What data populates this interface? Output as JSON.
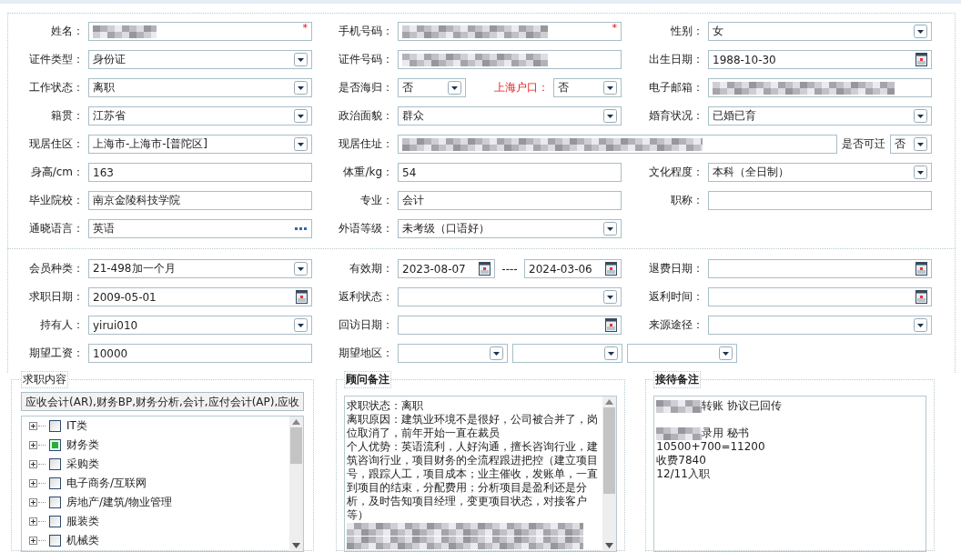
{
  "sections": [
    {
      "rows": [
        {
          "cells": [
            {
              "kind": "single",
              "label": "姓名：",
              "controls": [
                {
                  "kind": "text",
                  "redacted": true,
                  "required_mark": "*"
                }
              ]
            },
            {
              "kind": "single",
              "label": "手机号码：",
              "controls": [
                {
                  "kind": "text",
                  "redacted": true,
                  "required_mark": "*"
                }
              ]
            },
            {
              "kind": "single",
              "label": "性别：",
              "controls": [
                {
                  "kind": "select",
                  "value": "女"
                }
              ]
            }
          ]
        },
        {
          "cells": [
            {
              "kind": "single",
              "label": "证件类型：",
              "controls": [
                {
                  "kind": "select",
                  "value": "身份证"
                }
              ]
            },
            {
              "kind": "single",
              "label": "证件号码：",
              "controls": [
                {
                  "kind": "text",
                  "redacted": true
                }
              ]
            },
            {
              "kind": "single",
              "label": "出生日期：",
              "controls": [
                {
                  "kind": "date",
                  "value": "1988-10-30"
                }
              ]
            }
          ]
        },
        {
          "cells": [
            {
              "kind": "single",
              "label": "工作状态：",
              "controls": [
                {
                  "kind": "select",
                  "value": "离职"
                }
              ]
            },
            {
              "kind": "pair",
              "label": "是否海归：",
              "controls": [
                {
                  "kind": "select",
                  "value": "否"
                },
                {
                  "kind": "label",
                  "text": "上海户口：",
                  "emphasis": true
                },
                {
                  "kind": "select",
                  "value": "否"
                }
              ]
            },
            {
              "kind": "single",
              "label": "电子邮箱：",
              "controls": [
                {
                  "kind": "text",
                  "redacted": true
                }
              ]
            }
          ]
        },
        {
          "cells": [
            {
              "kind": "single",
              "label": "籍贯：",
              "controls": [
                {
                  "kind": "select",
                  "value": "江苏省"
                }
              ]
            },
            {
              "kind": "single",
              "label": "政治面貌：",
              "controls": [
                {
                  "kind": "select",
                  "value": "群众"
                }
              ]
            },
            {
              "kind": "single",
              "label": "婚育状况：",
              "controls": [
                {
                  "kind": "select",
                  "value": "已婚已育"
                }
              ]
            }
          ]
        },
        {
          "cells": [
            {
              "kind": "single",
              "label": "现居住区：",
              "controls": [
                {
                  "kind": "select",
                  "value": "上海市-上海市-[普陀区]"
                }
              ]
            },
            {
              "kind": "address",
              "label": "现居住址：",
              "controls": [
                {
                  "kind": "text",
                  "redacted": true
                },
                {
                  "kind": "label",
                  "text": "是否可迁"
                },
                {
                  "kind": "select",
                  "value": "否"
                }
              ]
            }
          ]
        },
        {
          "cells": [
            {
              "kind": "single",
              "label": "身高/cm：",
              "controls": [
                {
                  "kind": "text",
                  "value": "163"
                }
              ]
            },
            {
              "kind": "single",
              "label": "体重/kg：",
              "controls": [
                {
                  "kind": "text",
                  "value": "54"
                }
              ]
            },
            {
              "kind": "single",
              "label": "文化程度：",
              "controls": [
                {
                  "kind": "select",
                  "value": "本科（全日制）"
                }
              ]
            }
          ]
        },
        {
          "cells": [
            {
              "kind": "single",
              "label": "毕业院校：",
              "controls": [
                {
                  "kind": "text",
                  "value": "南京金陵科技学院"
                }
              ]
            },
            {
              "kind": "single",
              "label": "专业：",
              "controls": [
                {
                  "kind": "text",
                  "value": "会计"
                }
              ]
            },
            {
              "kind": "single",
              "label": "职称：",
              "controls": [
                {
                  "kind": "text"
                }
              ]
            }
          ]
        },
        {
          "cells": [
            {
              "kind": "single",
              "label": "通晓语言：",
              "controls": [
                {
                  "kind": "picker",
                  "value": "英语"
                }
              ]
            },
            {
              "kind": "single",
              "label": "外语等级：",
              "controls": [
                {
                  "kind": "select",
                  "value": "未考级（口语好）"
                }
              ]
            }
          ]
        }
      ]
    },
    {
      "rows": [
        {
          "cells": [
            {
              "kind": "single",
              "label": "会员种类：",
              "controls": [
                {
                  "kind": "select",
                  "value": "21-498加一个月"
                }
              ]
            },
            {
              "kind": "range",
              "label": "有效期：",
              "controls": [
                {
                  "kind": "date",
                  "value": "2023-08-07"
                },
                {
                  "kind": "separator",
                  "text": "----"
                },
                {
                  "kind": "date",
                  "value": "2024-03-06"
                }
              ]
            },
            {
              "kind": "single",
              "label": "退费日期：",
              "controls": [
                {
                  "kind": "date"
                }
              ]
            }
          ]
        },
        {
          "cells": [
            {
              "kind": "single",
              "label": "求职日期：",
              "controls": [
                {
                  "kind": "date",
                  "value": "2009-05-01"
                }
              ]
            },
            {
              "kind": "single",
              "label": "返利状态：",
              "controls": [
                {
                  "kind": "select"
                }
              ]
            },
            {
              "kind": "single",
              "label": "返利时间：",
              "controls": [
                {
                  "kind": "date"
                }
              ]
            }
          ]
        },
        {
          "cells": [
            {
              "kind": "single",
              "label": "持有人：",
              "controls": [
                {
                  "kind": "select",
                  "value": "yirui010"
                }
              ]
            },
            {
              "kind": "single",
              "label": "回访日期：",
              "controls": [
                {
                  "kind": "date"
                }
              ]
            },
            {
              "kind": "single",
              "label": "来源途径：",
              "controls": [
                {
                  "kind": "select"
                }
              ]
            }
          ]
        },
        {
          "cells": [
            {
              "kind": "single",
              "label": "期望工资：",
              "controls": [
                {
                  "kind": "text",
                  "value": "10000"
                }
              ]
            },
            {
              "kind": "regions",
              "label": "期望地区：",
              "controls": [
                {
                  "kind": "select"
                },
                {
                  "kind": "select"
                },
                {
                  "kind": "select"
                }
              ]
            }
          ]
        }
      ]
    }
  ],
  "job_content": {
    "legend": "求职内容",
    "legend_bold": false,
    "summary": "应收会计(AR),财务BP,财务分析,会计,应付会计(AP),应收",
    "tree": [
      {
        "label": "IT类",
        "checked": false
      },
      {
        "label": "财务类",
        "checked": true
      },
      {
        "label": "采购类",
        "checked": false
      },
      {
        "label": "电子商务/互联网",
        "checked": false
      },
      {
        "label": "房地产/建筑/物业管理",
        "checked": false
      },
      {
        "label": "服装类",
        "checked": false
      },
      {
        "label": "机械类",
        "checked": false
      }
    ]
  },
  "advisor_notes": {
    "legend": "顾问备注",
    "legend_bold": true,
    "scrollbar": true,
    "lines": [
      {
        "kind": "text",
        "text": "求职状态：离职"
      },
      {
        "kind": "text",
        "text": "离职原因：建筑业环境不是很好，公司被合并了，岗"
      },
      {
        "kind": "text",
        "text": "位取消了，前年开始一直在裁员"
      },
      {
        "kind": "text",
        "text": "个人优势：英语流利，人好沟通，擅长咨询行业，建"
      },
      {
        "kind": "text",
        "text": "筑咨询行业，项目财务的全流程跟进把控（建立项目"
      },
      {
        "kind": "text",
        "text": "号，跟踪人工，项目成本；业主催收，发账单，一直"
      },
      {
        "kind": "text",
        "text": "到项目的结束，分配费用；分析项目是盈利还是分"
      },
      {
        "kind": "text",
        "text": "析，及时告知项目经理，变更项目状态，对接客户"
      },
      {
        "kind": "text",
        "text": "等）"
      },
      {
        "kind": "redacted"
      },
      {
        "kind": "redacted"
      }
    ]
  },
  "reception_notes": {
    "legend": "接待备注",
    "legend_bold": true,
    "scrollbar": false,
    "lines": [
      {
        "kind": "text",
        "text": "转账  协议已回传",
        "redacted_prefix": true
      },
      {
        "kind": "blank"
      },
      {
        "kind": "text",
        "text": "录用  秘书",
        "redacted_prefix": true
      },
      {
        "kind": "text",
        "text": "10500+700=11200"
      },
      {
        "kind": "text",
        "text": "收费7840"
      },
      {
        "kind": "text",
        "text": "12/11入职"
      }
    ]
  }
}
